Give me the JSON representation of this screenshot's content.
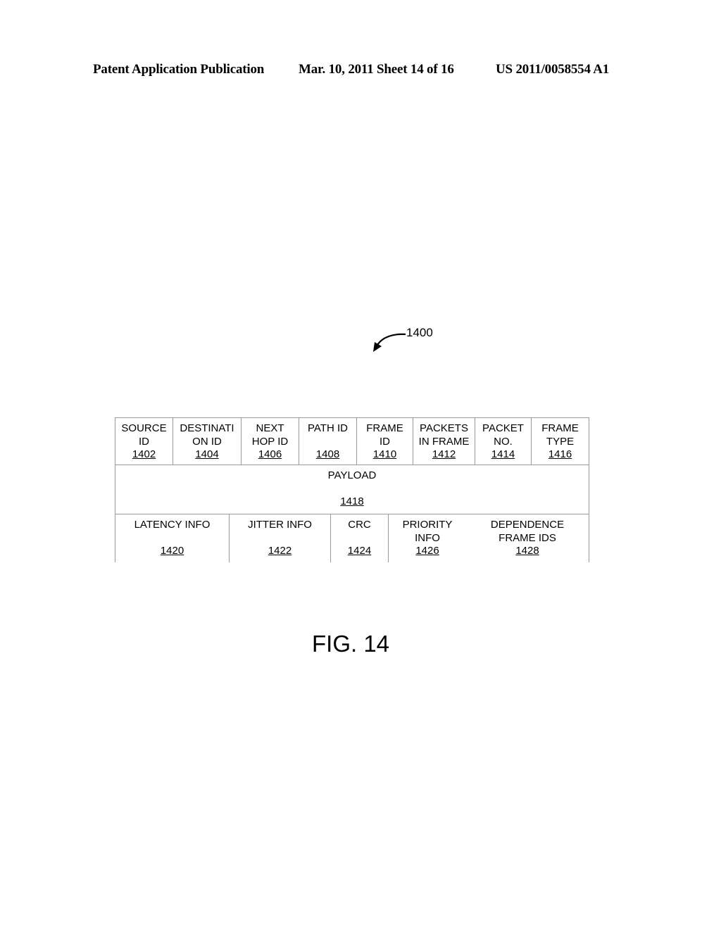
{
  "header": {
    "left": "Patent Application Publication",
    "middle": "Mar. 10, 2011  Sheet 14 of 16",
    "right": "US 2011/0058554 A1"
  },
  "figure_ref": "1400",
  "packet": {
    "row1": [
      {
        "lines": [
          "SOURCE",
          "ID"
        ],
        "ref": "1402"
      },
      {
        "lines": [
          "DESTINATI",
          "ON ID"
        ],
        "ref": "1404"
      },
      {
        "lines": [
          "NEXT",
          "HOP ID"
        ],
        "ref": "1406"
      },
      {
        "lines": [
          "PATH ID",
          ""
        ],
        "ref": "1408"
      },
      {
        "lines": [
          "FRAME",
          "ID"
        ],
        "ref": "1410"
      },
      {
        "lines": [
          "PACKETS",
          "IN FRAME"
        ],
        "ref": "1412"
      },
      {
        "lines": [
          "PACKET",
          "NO."
        ],
        "ref": "1414"
      },
      {
        "lines": [
          "FRAME",
          "TYPE"
        ],
        "ref": "1416"
      }
    ],
    "payload": {
      "label": "PAYLOAD",
      "ref": "1418"
    },
    "row3": [
      {
        "lines": [
          "LATENCY INFO",
          ""
        ],
        "ref": "1420"
      },
      {
        "lines": [
          "JITTER INFO",
          ""
        ],
        "ref": "1422"
      },
      {
        "lines": [
          "CRC",
          ""
        ],
        "ref": "1424"
      },
      {
        "lines": [
          "PRIORITY",
          "INFO"
        ],
        "ref": "1426"
      },
      {
        "lines": [
          "DEPENDENCE",
          "FRAME IDS"
        ],
        "ref": "1428"
      }
    ]
  },
  "figure_label": "FIG. 14"
}
